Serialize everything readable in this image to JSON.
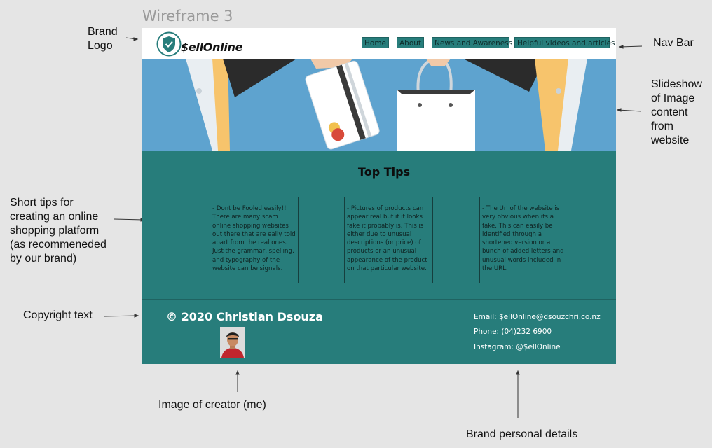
{
  "frame_title": "Wireframe 3",
  "annotations": {
    "brand_logo": "Brand\nLogo",
    "nav_bar": "Nav Bar",
    "slideshow": "Slideshow\nof Image\ncontent\nfrom\nwebsite",
    "short_tips": "Short tips for\ncreating an online\nshopping platform\n(as recommeneded\nby our brand)",
    "copyright_text": "Copyright text",
    "creator_image": "Image of creator (me)",
    "brand_details": "Brand personal details"
  },
  "site": {
    "brand": "$ellOnline",
    "nav": [
      "Home",
      "About",
      "News and Awareness",
      "Helpful videos and articles"
    ],
    "tips_title": "Top Tips",
    "tips": [
      "-  Dont be Fooled easily!! There are many scam online shopping websites out there that are eaily told apart from the real ones. Just the grammar, spelling, and typography of the website can be signals.",
      "- Pictures of products can appear real but if it looks fake it probably is. This is either due to unusual descriptions (or price) of products or an unusual appearance of the product on that particular website.",
      "- The Url of the website is very obvious when its a fake. This can easily be identified through a shortened version or a bunch of added letters and unusual words included in the URL."
    ],
    "copyright": "© 2020 Christian Dsouza",
    "contact": {
      "email": "Email: $ellOnline@dsouzchri.co.nz",
      "phone": "Phone: (04)232 6900",
      "instagram": "Instagram: @$ellOnline"
    }
  },
  "colors": {
    "teal": "#277d7b",
    "sky": "#5ea3cf",
    "canvas": "#e5e5e5"
  }
}
